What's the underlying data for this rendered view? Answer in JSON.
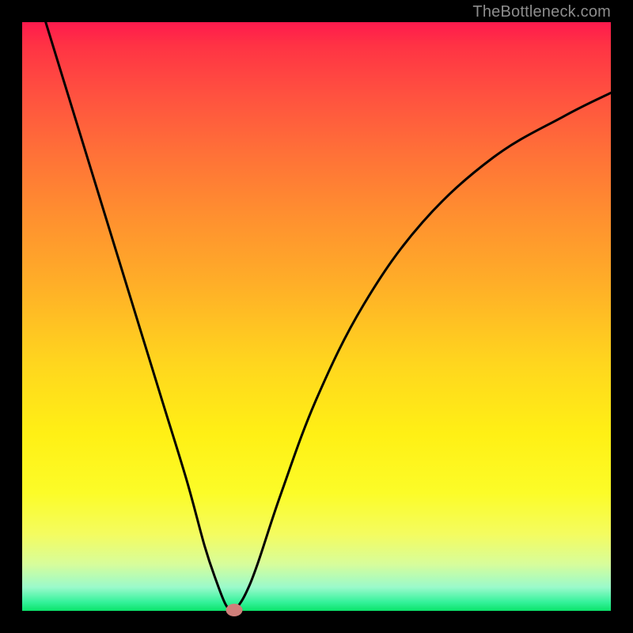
{
  "watermark": "TheBottleneck.com",
  "chart_data": {
    "type": "line",
    "title": "",
    "xlabel": "",
    "ylabel": "",
    "xlim": [
      0,
      100
    ],
    "ylim": [
      0,
      100
    ],
    "gradient_stops": [
      {
        "pos": 0,
        "color": "#ff1a4d"
      },
      {
        "pos": 12,
        "color": "#ff5040"
      },
      {
        "pos": 32,
        "color": "#ff8d30"
      },
      {
        "pos": 58,
        "color": "#ffd61e"
      },
      {
        "pos": 80,
        "color": "#fcfc28"
      },
      {
        "pos": 96,
        "color": "#9afacb"
      },
      {
        "pos": 100,
        "color": "#0be36b"
      }
    ],
    "series": [
      {
        "name": "bottleneck-curve",
        "x": [
          4,
          8,
          12,
          16,
          20,
          24,
          28,
          31,
          33,
          34.5,
          35.5,
          36.5,
          38,
          40,
          44,
          50,
          58,
          68,
          80,
          92,
          100
        ],
        "y": [
          100,
          87,
          74,
          61,
          48,
          35,
          22,
          11,
          5,
          1.2,
          0.2,
          0.6,
          3,
          8,
          20,
          36,
          52,
          66,
          77,
          84,
          88
        ]
      }
    ],
    "marker": {
      "x": 36,
      "y": 0.2,
      "color": "#cf7f7a"
    }
  }
}
